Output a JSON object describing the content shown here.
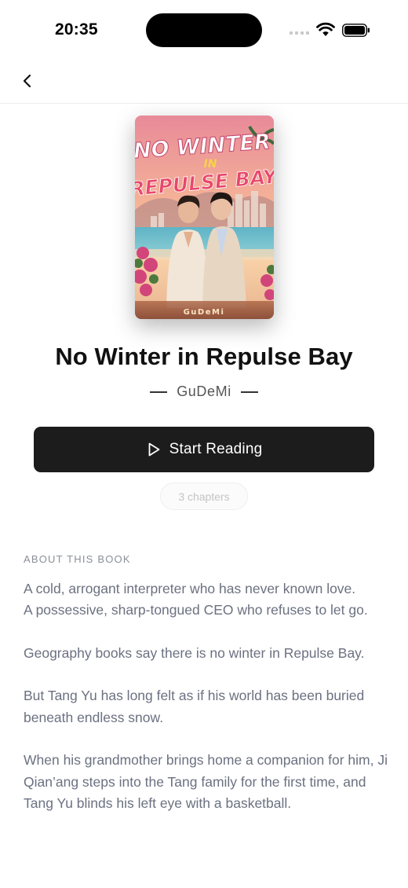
{
  "status_bar": {
    "time": "20:35"
  },
  "nav": {
    "back_icon": "chevron-left-icon"
  },
  "book": {
    "title": "No Winter in Repulse Bay",
    "author": "GuDeMi",
    "cover": {
      "title_line1": "NO WINTER",
      "title_line2": "IN",
      "title_line3": "REPULSE BAY",
      "author": "GuDeMi"
    }
  },
  "actions": {
    "start_reading": "Start Reading",
    "chapters": "3 chapters"
  },
  "about": {
    "heading": "ABOUT THIS BOOK",
    "paragraphs": [
      "A cold, arrogant interpreter who has never known love.\nA possessive, sharp-tongued CEO who refuses to let go.",
      "Geography books say there is no winter in Repulse Bay.",
      "But Tang Yu has long felt as if his world has been buried beneath endless snow.",
      "When his grandmother brings home a companion for him, Ji Qian’ang steps into the Tang family for the first time, and Tang Yu blinds his left eye with a basketball."
    ]
  },
  "colors": {
    "button_bg": "#1c1c1c",
    "text_muted": "#6b7180",
    "heading_muted": "#8a8f98"
  }
}
